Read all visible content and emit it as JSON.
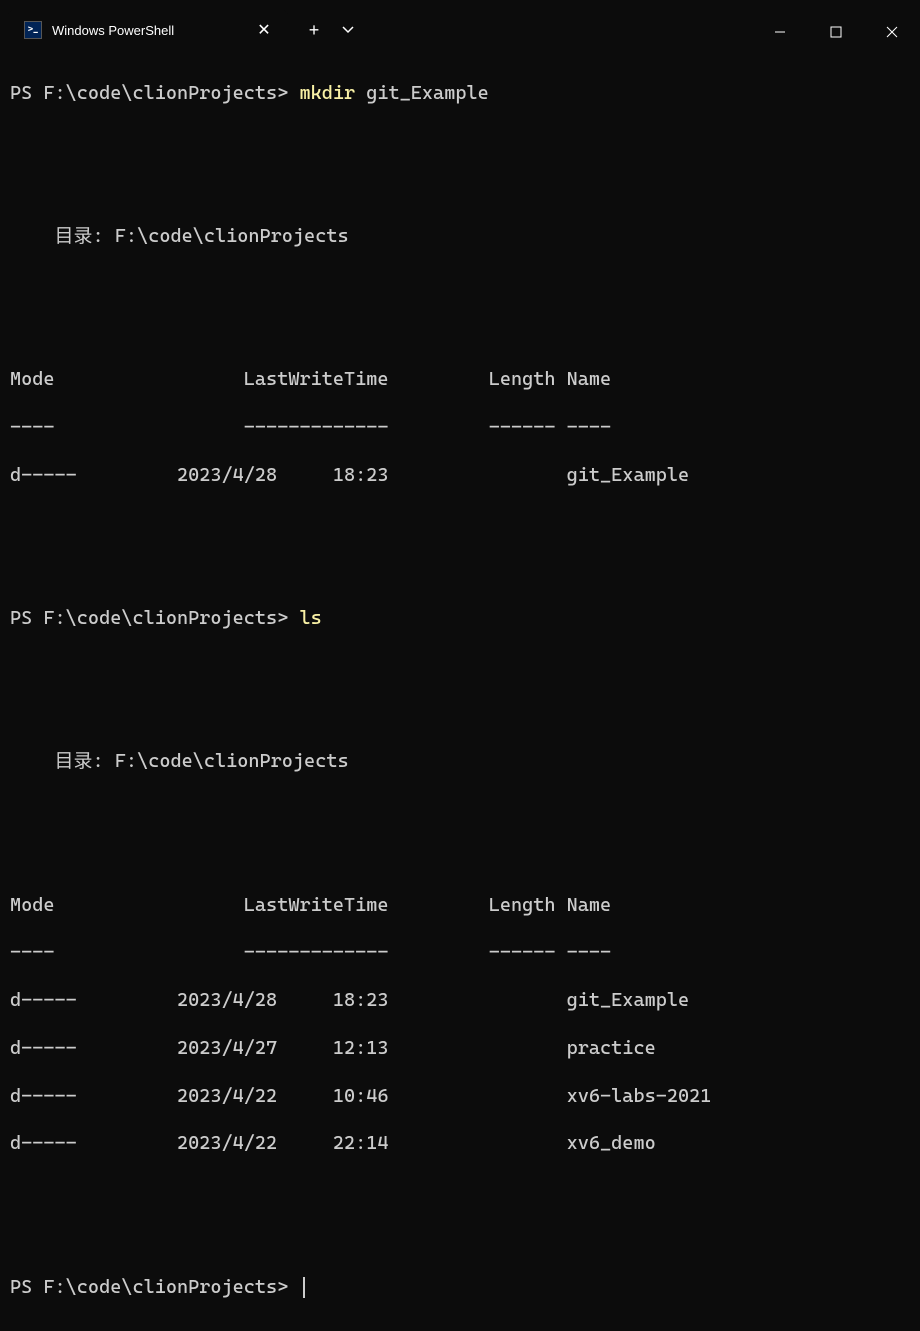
{
  "titlebar": {
    "tab_title": "Windows PowerShell"
  },
  "terminal": {
    "prompt1": "PS F:\\code\\clionProjects> ",
    "cmd1": "mkdir",
    "arg1": " git_Example",
    "dir_header1": "    目录: F:\\code\\clionProjects",
    "tbl_header": "Mode                 LastWriteTime         Length Name",
    "tbl_sep": "----                 -------------         ------ ----",
    "row1_1": "d-----         2023/4/28     18:23                git_Example",
    "prompt2": "PS F:\\code\\clionProjects> ",
    "cmd2": "ls",
    "dir_header2": "    目录: F:\\code\\clionProjects",
    "row2_1": "d-----         2023/4/28     18:23                git_Example",
    "row2_2": "d-----         2023/4/27     12:13                practice",
    "row2_3": "d-----         2023/4/22     10:46                xv6-labs-2021",
    "row2_4": "d-----         2023/4/22     22:14                xv6_demo",
    "prompt3": "PS F:\\code\\clionProjects> "
  }
}
